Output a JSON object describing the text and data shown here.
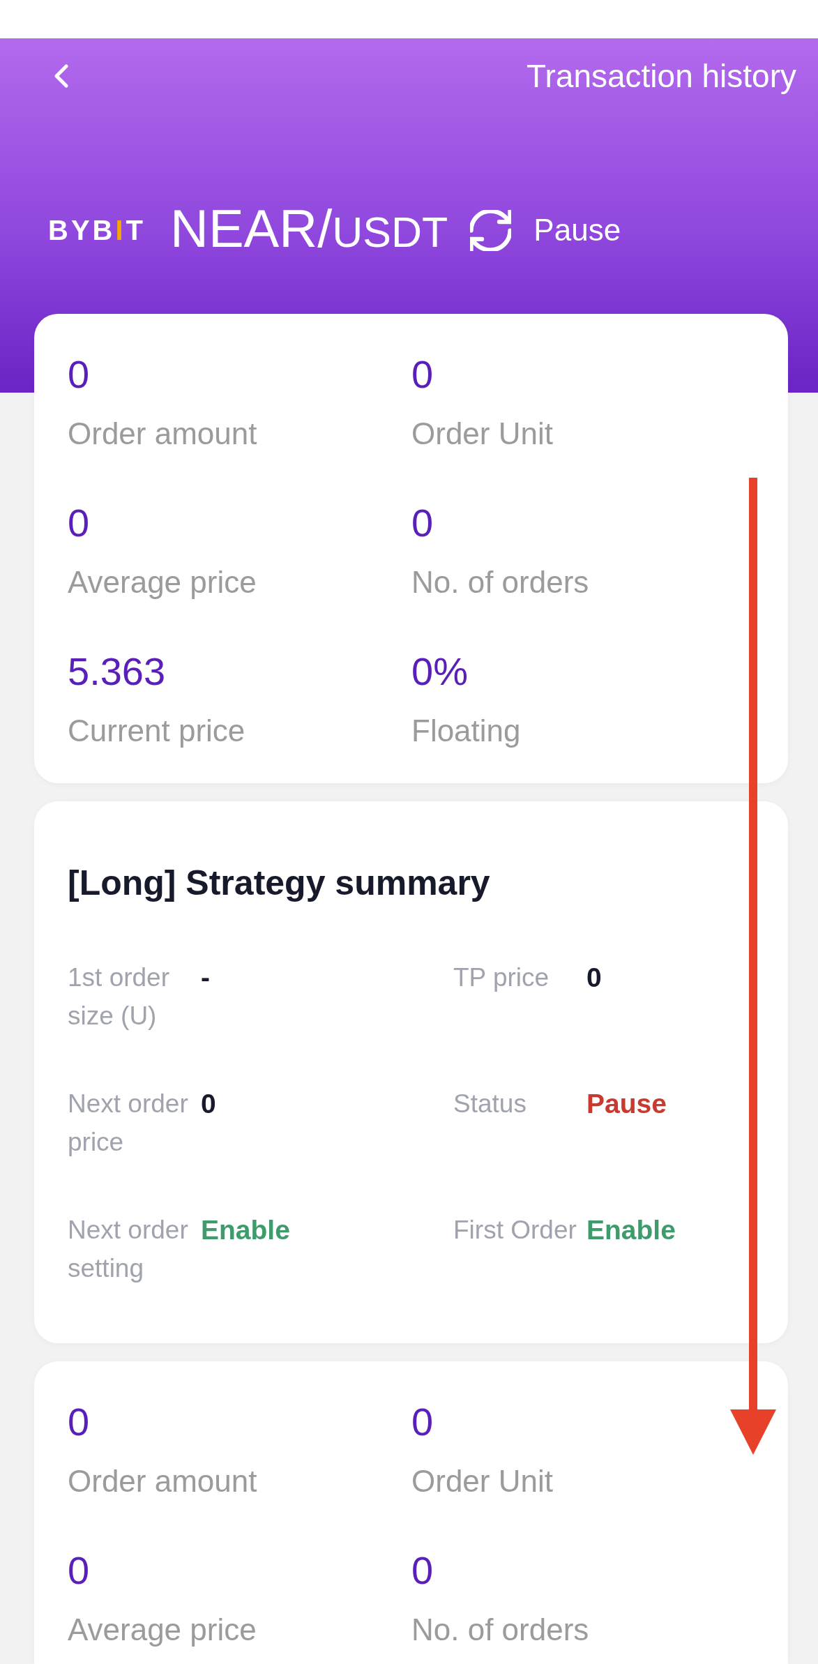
{
  "header": {
    "link": "Transaction history",
    "logo": [
      {
        "text": "BYB",
        "color": "#ffffff"
      },
      {
        "text": "I",
        "color": "#f7a600"
      },
      {
        "text": "T",
        "color": "#ffffff"
      }
    ],
    "pair": {
      "base": "NEAR/",
      "quote": "USDT"
    },
    "status": "Pause"
  },
  "cards": [
    {
      "kind": "stats",
      "items": [
        {
          "value": "0",
          "label": "Order amount"
        },
        {
          "value": "0",
          "label": "Order Unit"
        },
        {
          "value": "0",
          "label": "Average price"
        },
        {
          "value": "0",
          "label": "No. of orders"
        },
        {
          "value": "5.363",
          "label": "Current price"
        },
        {
          "value": "0%",
          "label": "Floating"
        }
      ]
    },
    {
      "kind": "summary",
      "title": "[Long] Strategy summary",
      "items": [
        {
          "label": "1st order size (U)",
          "value": "-",
          "color": "#161a2b"
        },
        {
          "label": "TP price",
          "value": "0",
          "color": "#161a2b"
        },
        {
          "label": "Next order price",
          "value": "0",
          "color": "#161a2b"
        },
        {
          "label": "Status",
          "value": "Pause",
          "color": "#c9392f"
        },
        {
          "label": "Next order setting",
          "value": "Enable",
          "color": "#3e9b6c"
        },
        {
          "label": "First Order",
          "value": "Enable",
          "color": "#3e9b6c"
        }
      ]
    },
    {
      "kind": "stats",
      "items": [
        {
          "value": "0",
          "label": "Order amount"
        },
        {
          "value": "0",
          "label": "Order Unit"
        },
        {
          "value": "0",
          "label": "Average price"
        },
        {
          "value": "0",
          "label": "No. of orders"
        }
      ]
    }
  ]
}
